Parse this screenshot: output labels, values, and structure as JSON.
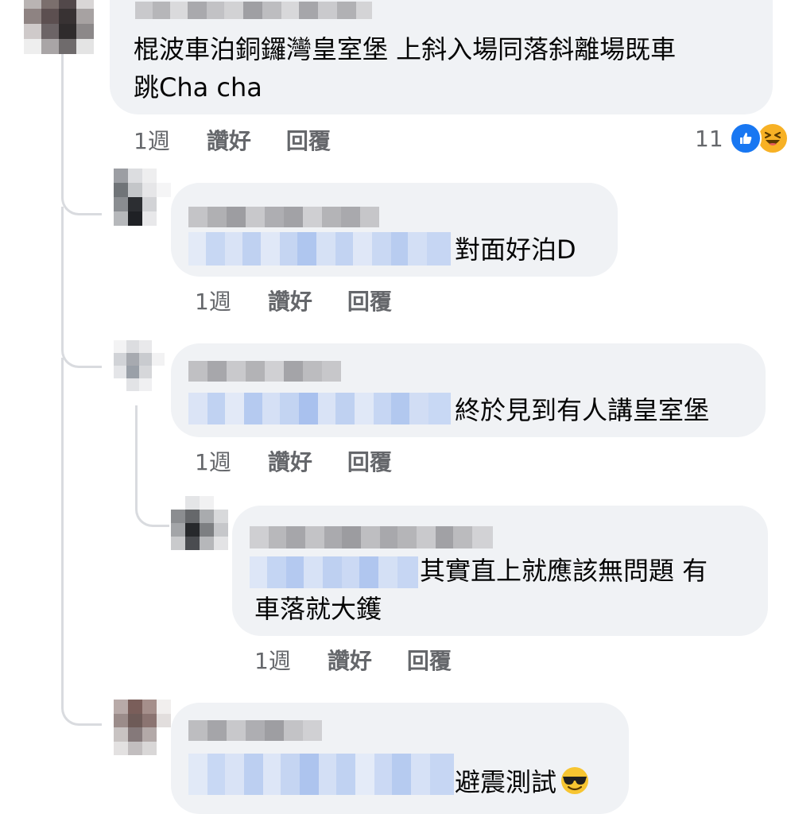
{
  "comments": [
    {
      "text_lines": [
        "棍波車泊銅鑼灣皇室堡 上斜入場同落斜離場既車",
        "跳Cha cha"
      ],
      "time": "1週",
      "like_label": "讚好",
      "reply_label": "回覆",
      "reaction_count": "11",
      "reaction_icons": [
        "like-reaction-icon",
        "haha-reaction-icon"
      ]
    },
    {
      "text_lines": [
        "對面好泊D"
      ],
      "time": "1週",
      "like_label": "讚好",
      "reply_label": "回覆"
    },
    {
      "text_lines": [
        "終於見到有人講皇室堡"
      ],
      "time": "1週",
      "like_label": "讚好",
      "reply_label": "回覆"
    },
    {
      "text_lines": [
        "其實直上就應該無問題 有",
        "車落就大鑊"
      ],
      "time": "1週",
      "like_label": "讚好",
      "reply_label": "回覆"
    },
    {
      "text_lines": [
        "避震測試"
      ],
      "emoji": "smiling-face-with-sunglasses-icon"
    }
  ],
  "colors": {
    "bubble": "#f0f2f5",
    "meta_text": "#65676b",
    "like_blue": "#1877f2",
    "haha_yellow": "#f7b125",
    "blur_gray": "#b9b9bc",
    "blur_blue": "#c8d8f4"
  }
}
